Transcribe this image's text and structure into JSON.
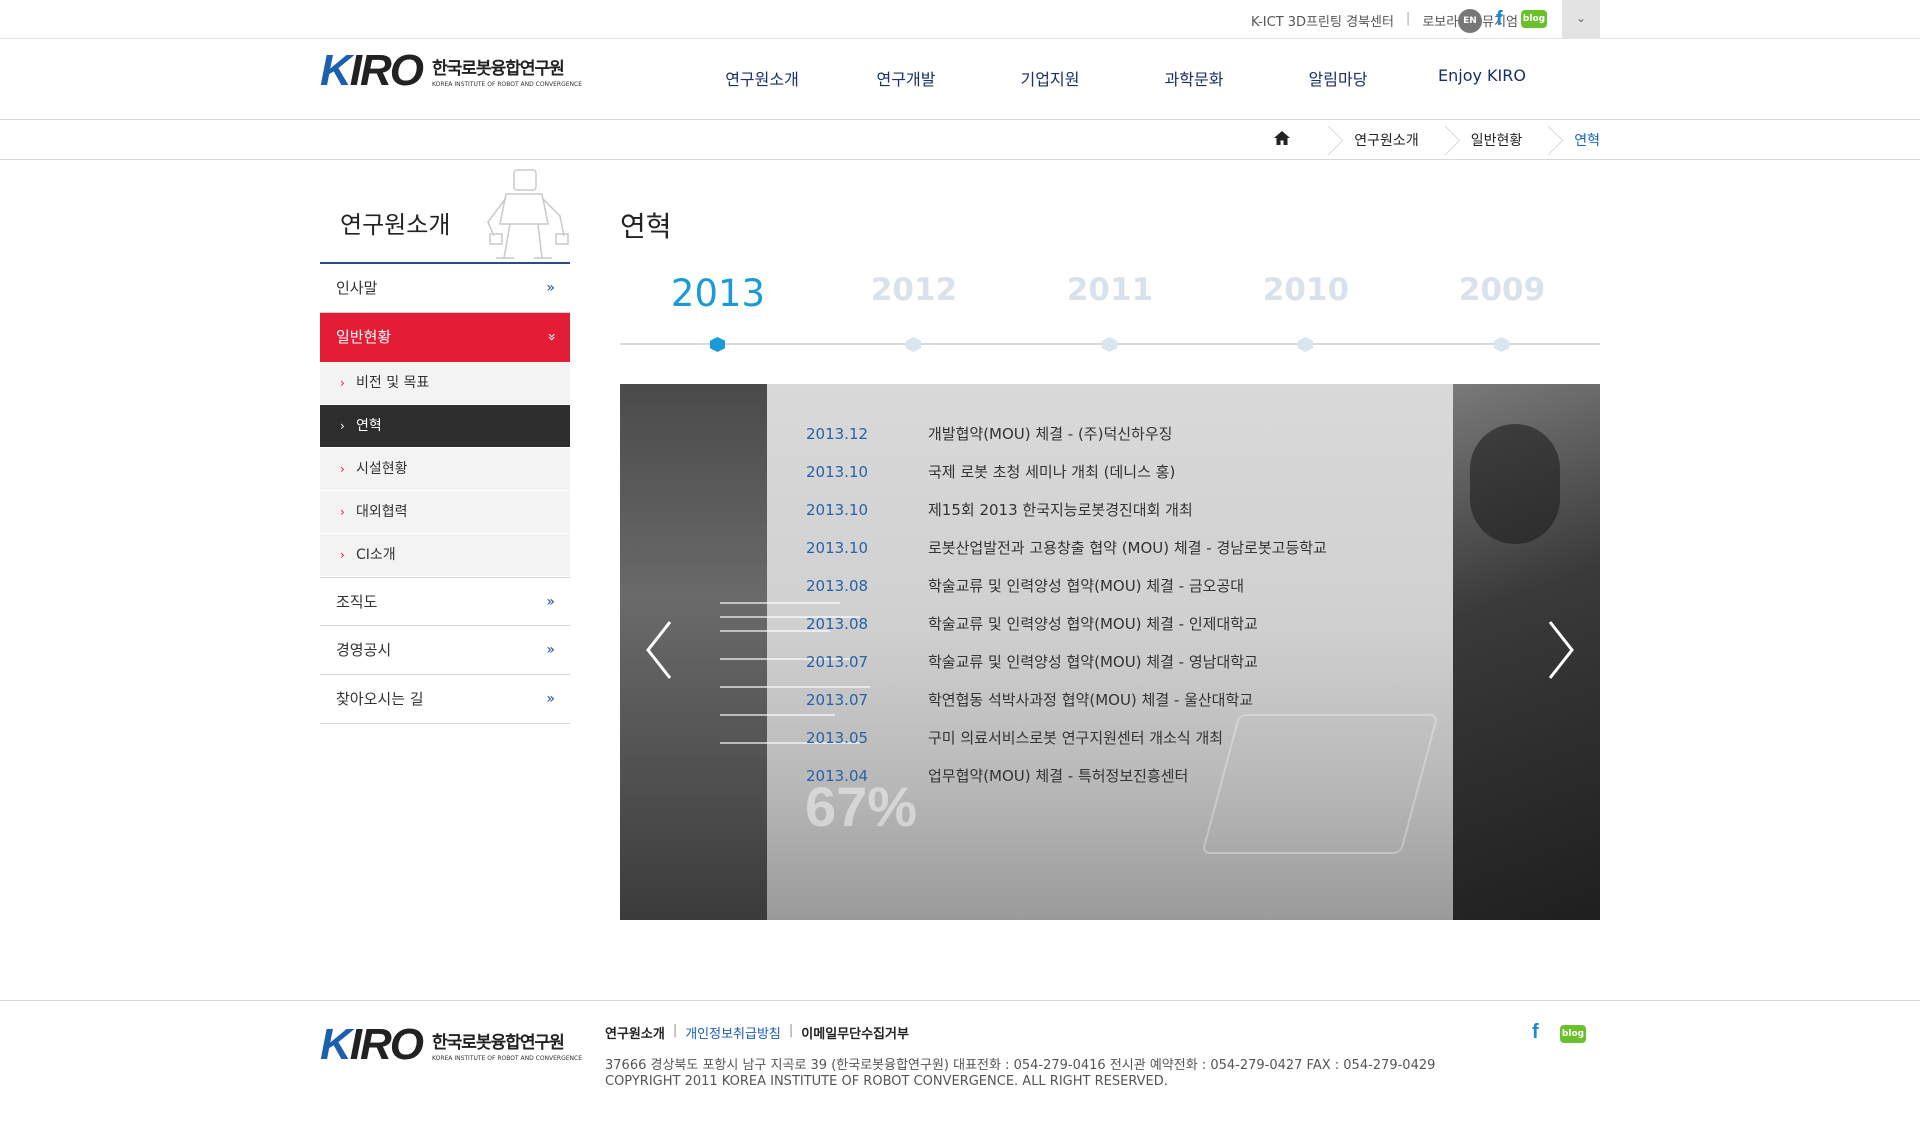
{
  "util": {
    "link1": "K-ICT 3D프린팅 경북센터",
    "link2": "로보라이프뮤지엄",
    "en": "EN",
    "blog": "blog"
  },
  "logo": {
    "mark": "KIRO",
    "kr": "한국로봇융합연구원",
    "en": "KOREA INSTITUTE OF ROBOT AND CONVERGENCE"
  },
  "gnb": [
    "연구원소개",
    "연구개발",
    "기업지원",
    "과학문화",
    "알림마당",
    "Enjoy KIRO"
  ],
  "breadcrumb": [
    "연구원소개",
    "일반현황",
    "연혁"
  ],
  "snb": {
    "title": "연구원소개",
    "items": [
      "인사말",
      "일반현황",
      "조직도",
      "경영공시",
      "찾아오시는 길"
    ],
    "sub": [
      "비전 및 목표",
      "연혁",
      "시설현황",
      "대외협력",
      "CI소개"
    ]
  },
  "content": {
    "title": "연혁",
    "years": [
      "2013",
      "2012",
      "2011",
      "2010",
      "2009"
    ],
    "panel_percent": "67%",
    "history": [
      {
        "date": "2013.12",
        "text": "개발협약(MOU) 체결 - (주)덕신하우징"
      },
      {
        "date": "2013.10",
        "text": "국제 로봇 초청 세미나 개최 (데니스 홍)"
      },
      {
        "date": "2013.10",
        "text": "제15회 2013 한국지능로봇경진대회 개최"
      },
      {
        "date": "2013.10",
        "text": "로봇산업발전과 고용창출 협약 (MOU) 체결 - 경남로봇고등학교"
      },
      {
        "date": "2013.08",
        "text": "학술교류 및 인력양성 협약(MOU) 체결 - 금오공대"
      },
      {
        "date": "2013.08",
        "text": "학술교류 및 인력양성 협약(MOU) 체결 - 인제대학교"
      },
      {
        "date": "2013.07",
        "text": "학술교류 및 인력양성 협약(MOU) 체결 - 영남대학교"
      },
      {
        "date": "2013.07",
        "text": "학연협동 석박사과정 협약(MOU) 체결 - 울산대학교"
      },
      {
        "date": "2013.05",
        "text": "구미 의료서비스로봇 연구지원센터 개소식 개최"
      },
      {
        "date": "2013.04",
        "text": "업무협약(MOU) 체결 - 특허정보진흥센터"
      }
    ]
  },
  "footer": {
    "link1": "연구원소개",
    "link2": "개인정보취급방침",
    "link3": "이메일무단수집거부",
    "address": "37666 경상북도 포항시 남구 지곡로 39 (한국로봇융합연구원)   대표전화 : 054-279-0416   전시관 예약전화 : 054-279-0427   FAX : 054-279-0429",
    "copyright": "COPYRIGHT 2011 KOREA INSTITUTE OF ROBOT CONVERGENCE. ALL RIGHT RESERVED."
  },
  "colors": {
    "accent_red": "#e31d35",
    "accent_blue": "#1a9ad6",
    "nav_blue": "#1a2f66"
  }
}
